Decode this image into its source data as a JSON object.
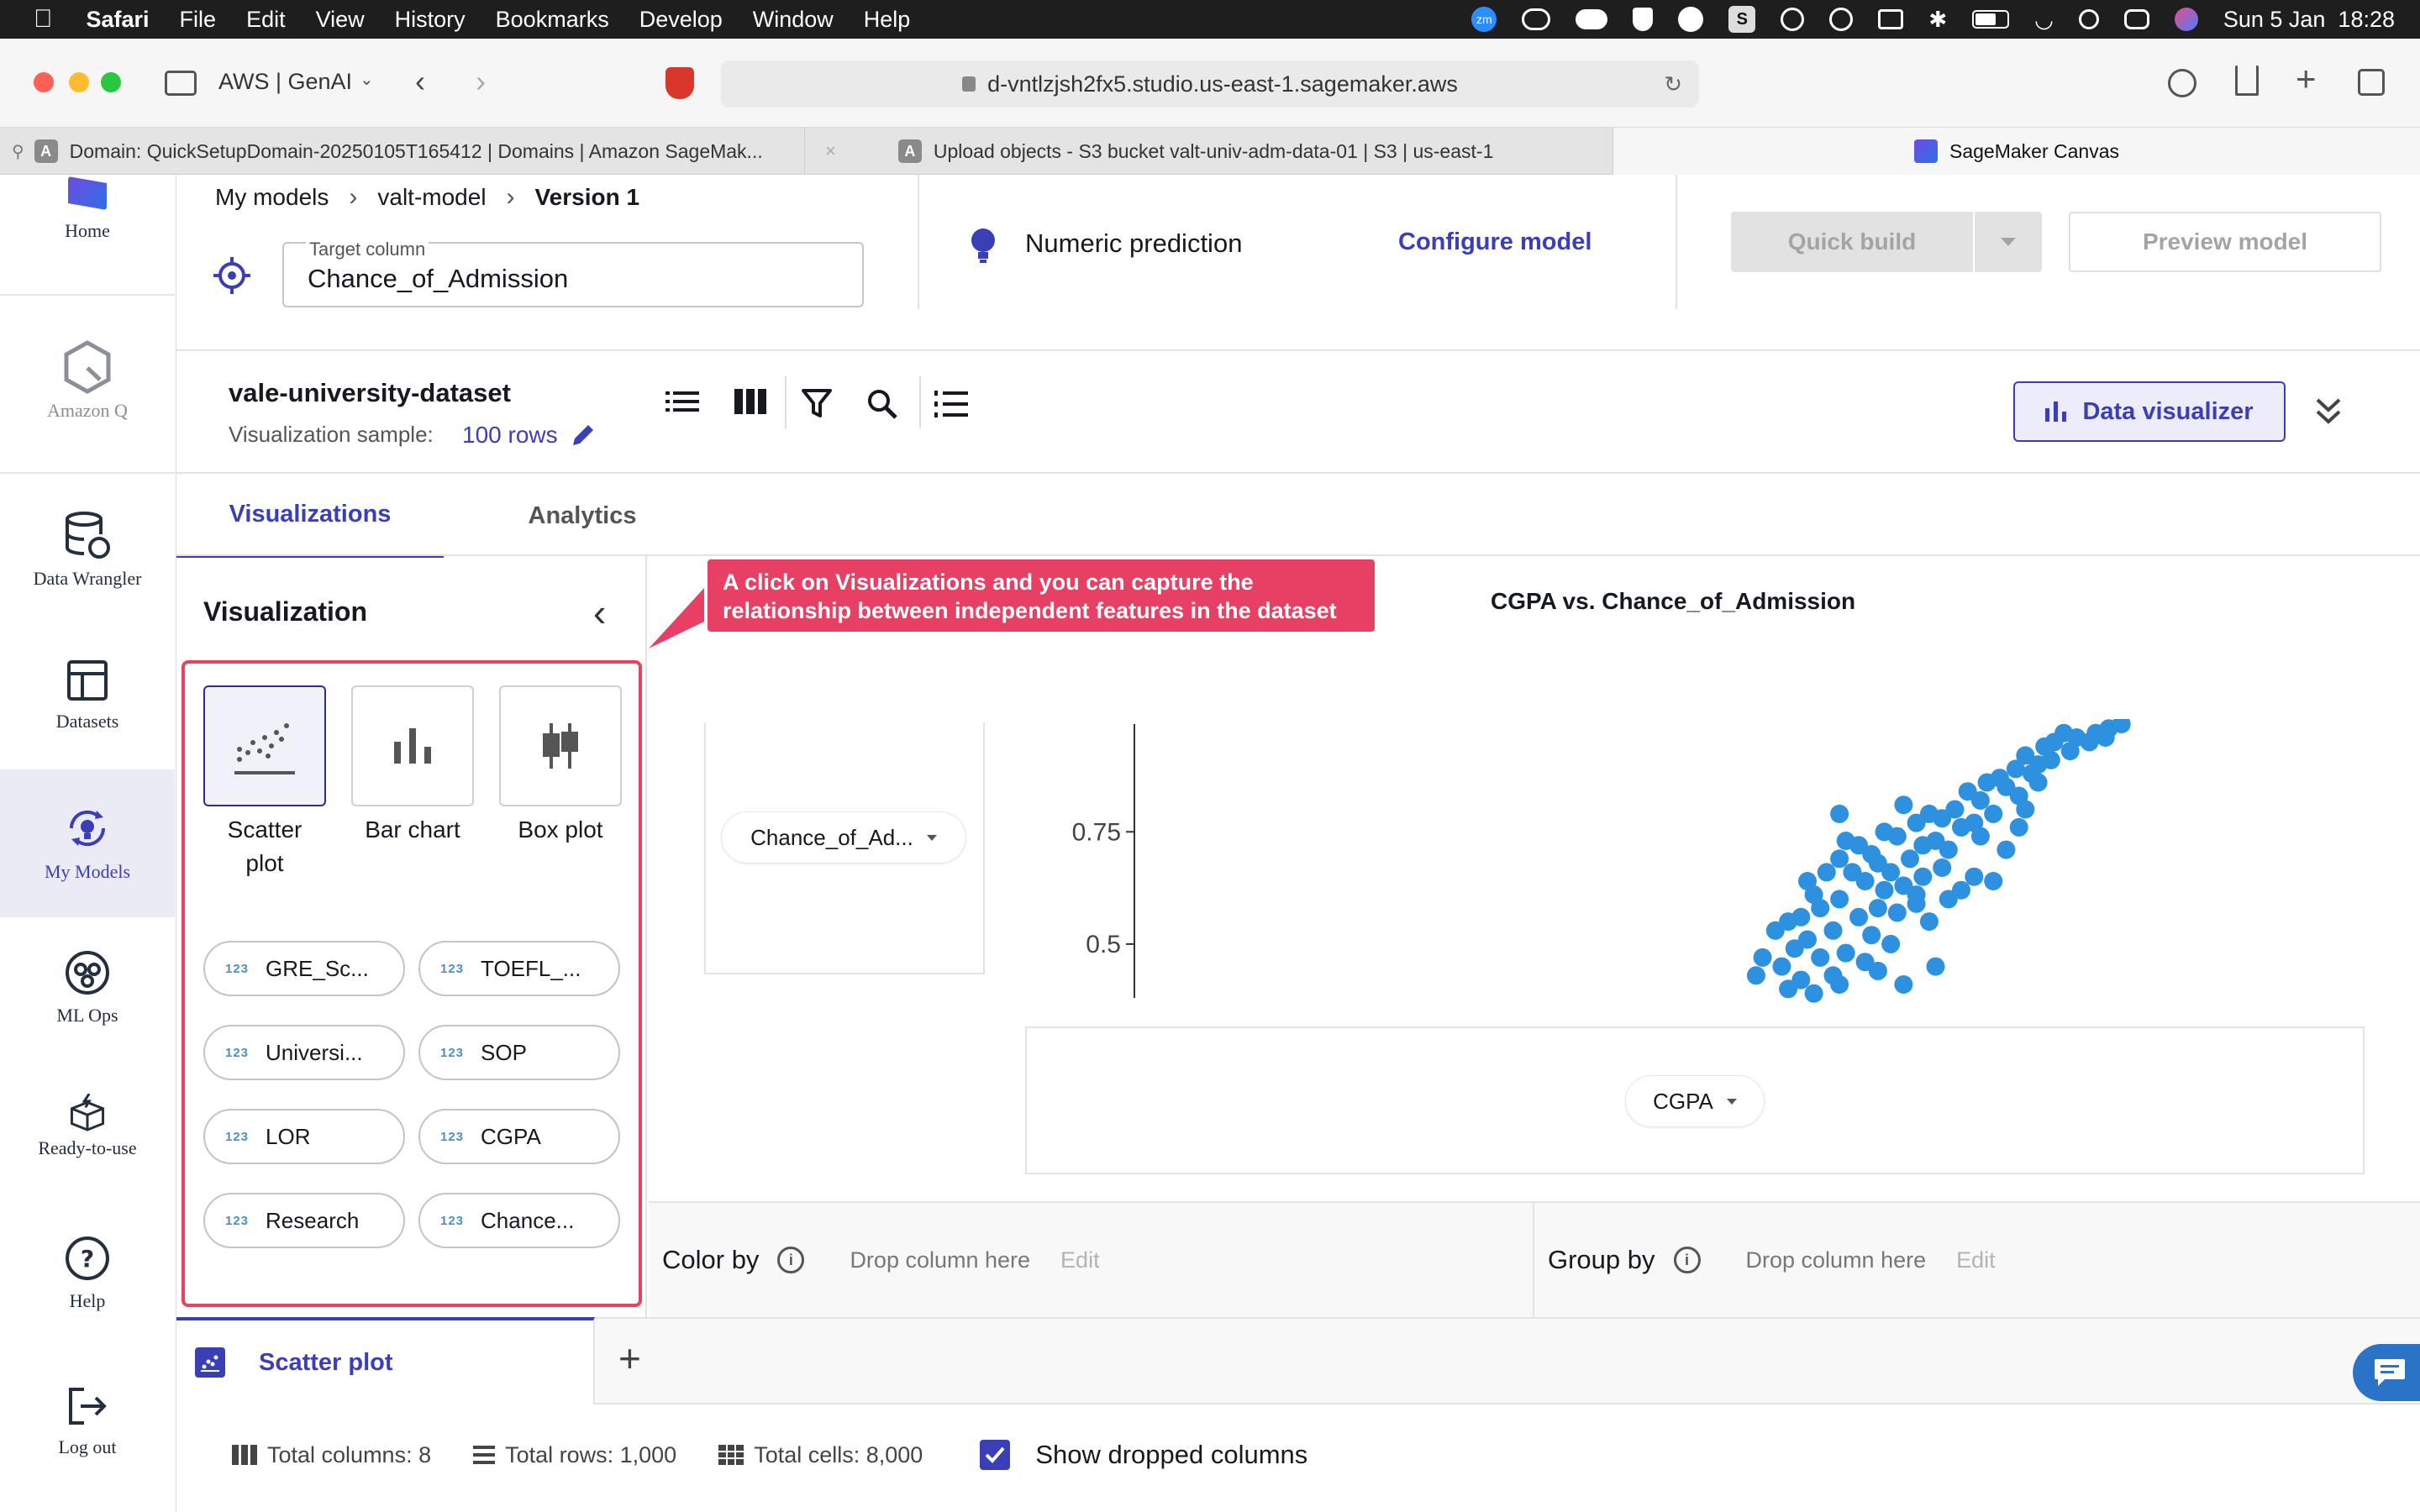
{
  "menubar": {
    "app": "Safari",
    "items": [
      "File",
      "Edit",
      "View",
      "History",
      "Bookmarks",
      "Develop",
      "Window",
      "Help"
    ],
    "clock": "Sun 5 Jan  18:28",
    "zoom_badge": "zm"
  },
  "browser": {
    "sidebar_title": "AWS | GenAI",
    "url": "d-vntlzjsh2fx5.studio.us-east-1.sagemaker.aws",
    "tabs": [
      {
        "label": "Domain: QuickSetupDomain-20250105T165412 | Domains | Amazon SageMak...",
        "favicon": "A"
      },
      {
        "label": "Upload objects - S3 bucket valt-univ-adm-data-01 | S3 | us-east-1",
        "favicon": "A"
      },
      {
        "label": "SageMaker Canvas"
      }
    ]
  },
  "leftnav": {
    "items": [
      {
        "label": "Home",
        "icon": "canvas-logo-icon"
      },
      {
        "label": "Amazon Q",
        "icon": "amazon-q-icon"
      },
      {
        "label": "Data Wrangler",
        "icon": "database-icon"
      },
      {
        "label": "Datasets",
        "icon": "table-icon"
      },
      {
        "label": "My Models",
        "icon": "lightbulb-refresh-icon"
      },
      {
        "label": "ML Ops",
        "icon": "mlops-gear-icon"
      },
      {
        "label": "Ready-to-use",
        "icon": "package-icon"
      },
      {
        "label": "Help",
        "icon": "help-icon"
      },
      {
        "label": "Log out",
        "icon": "logout-icon"
      }
    ]
  },
  "header": {
    "breadcrumb": [
      "My models",
      "valt-model",
      "Version 1"
    ],
    "target_label": "Target column",
    "target_value": "Chance_of_Admission",
    "model_type": "Numeric prediction",
    "configure": "Configure model",
    "quick_build": "Quick build",
    "preview": "Preview model"
  },
  "dataset": {
    "name": "vale-university-dataset",
    "sample_label": "Visualization sample:",
    "sample_value": "100 rows",
    "visualizer_btn": "Data visualizer"
  },
  "tabs": {
    "visualizations": "Visualizations",
    "analytics": "Analytics"
  },
  "panel": {
    "title": "Visualization",
    "types": [
      "Scatter plot",
      "Bar chart",
      "Box plot"
    ],
    "badge": "123",
    "columns": [
      "GRE_Sc...",
      "TOEFL_...",
      "Universi...",
      "SOP",
      "LOR",
      "CGPA",
      "Research",
      "Chance..."
    ]
  },
  "callout": {
    "line1": "A click on Visualizations and you can capture the",
    "line2": "relationship between independent features in the dataset",
    "color": "#e83f65"
  },
  "chart": {
    "y_dropdown": "Chance_of_Ad...",
    "x_dropdown": "CGPA"
  },
  "chart_data": {
    "type": "scatter",
    "title": "CGPA vs. Chance_of_Admission",
    "xlabel": "CGPA",
    "ylabel": "Chance_of_Admission",
    "yticks": [
      "0.75",
      "0.5"
    ],
    "ylim": [
      0.38,
      0.99
    ],
    "xlim": [
      6.8,
      9.92
    ],
    "color": "#2e91e0",
    "points": [
      [
        9.7,
        0.97
      ],
      [
        9.74,
        0.96
      ],
      [
        9.8,
        0.97
      ],
      [
        9.84,
        0.98
      ],
      [
        9.88,
        0.99
      ],
      [
        9.64,
        0.94
      ],
      [
        9.67,
        0.95
      ],
      [
        9.72,
        0.93
      ],
      [
        9.78,
        0.95
      ],
      [
        9.83,
        0.96
      ],
      [
        9.58,
        0.92
      ],
      [
        9.62,
        0.9
      ],
      [
        9.55,
        0.89
      ],
      [
        9.6,
        0.88
      ],
      [
        9.5,
        0.87
      ],
      [
        9.66,
        0.91
      ],
      [
        9.46,
        0.86
      ],
      [
        9.52,
        0.85
      ],
      [
        9.4,
        0.84
      ],
      [
        9.56,
        0.83
      ],
      [
        9.44,
        0.82
      ],
      [
        9.36,
        0.8
      ],
      [
        9.48,
        0.79
      ],
      [
        9.32,
        0.78
      ],
      [
        9.42,
        0.77
      ],
      [
        9.28,
        0.79
      ],
      [
        9.38,
        0.76
      ],
      [
        9.24,
        0.77
      ],
      [
        9.2,
        0.81
      ],
      [
        9.3,
        0.73
      ],
      [
        9.18,
        0.74
      ],
      [
        9.26,
        0.72
      ],
      [
        9.14,
        0.75
      ],
      [
        9.1,
        0.7
      ],
      [
        9.22,
        0.69
      ],
      [
        9.34,
        0.71
      ],
      [
        9.06,
        0.72
      ],
      [
        9.12,
        0.68
      ],
      [
        9.02,
        0.73
      ],
      [
        9.16,
        0.66
      ],
      [
        9.26,
        0.65
      ],
      [
        9.04,
        0.66
      ],
      [
        9.08,
        0.64
      ],
      [
        9.0,
        0.69
      ],
      [
        8.96,
        0.66
      ],
      [
        9.2,
        0.63
      ],
      [
        9.32,
        0.67
      ],
      [
        9.42,
        0.65
      ],
      [
        8.92,
        0.61
      ],
      [
        9.0,
        0.6
      ],
      [
        9.12,
        0.58
      ],
      [
        9.06,
        0.56
      ],
      [
        8.94,
        0.58
      ],
      [
        8.88,
        0.56
      ],
      [
        9.18,
        0.57
      ],
      [
        9.24,
        0.59
      ],
      [
        8.84,
        0.55
      ],
      [
        9.28,
        0.55
      ],
      [
        8.98,
        0.53
      ],
      [
        8.9,
        0.51
      ],
      [
        9.1,
        0.52
      ],
      [
        8.8,
        0.53
      ],
      [
        8.86,
        0.49
      ],
      [
        9.02,
        0.48
      ],
      [
        8.94,
        0.47
      ],
      [
        9.16,
        0.5
      ],
      [
        8.82,
        0.45
      ],
      [
        9.08,
        0.46
      ],
      [
        8.76,
        0.47
      ],
      [
        8.98,
        0.43
      ],
      [
        8.88,
        0.42
      ],
      [
        9.0,
        0.41
      ],
      [
        8.92,
        0.39
      ],
      [
        9.12,
        0.44
      ],
      [
        8.74,
        0.43
      ],
      [
        9.3,
        0.45
      ],
      [
        8.84,
        0.4
      ],
      [
        9.2,
        0.41
      ],
      [
        9.24,
        0.61
      ],
      [
        9.38,
        0.62
      ],
      [
        9.48,
        0.64
      ],
      [
        9.52,
        0.71
      ],
      [
        9.44,
        0.74
      ],
      [
        9.14,
        0.62
      ],
      [
        8.9,
        0.64
      ],
      [
        9.34,
        0.6
      ],
      [
        9.56,
        0.76
      ],
      [
        9.62,
        0.86
      ],
      [
        9.0,
        0.79
      ],
      [
        9.58,
        0.8
      ]
    ]
  },
  "groupbar": {
    "color_by": "Color by",
    "group_by": "Group by",
    "drop": "Drop column here",
    "edit": "Edit"
  },
  "bottomtab": {
    "label": "Scatter plot"
  },
  "footer": {
    "total_columns": "Total columns: 8",
    "total_rows": "Total rows: 1,000",
    "total_cells": "Total cells: 8,000",
    "show_dropped": "Show dropped columns"
  },
  "colors": {
    "accent": "#3b3fb6",
    "chart": "#2e91e0",
    "callout": "#e83f65"
  }
}
